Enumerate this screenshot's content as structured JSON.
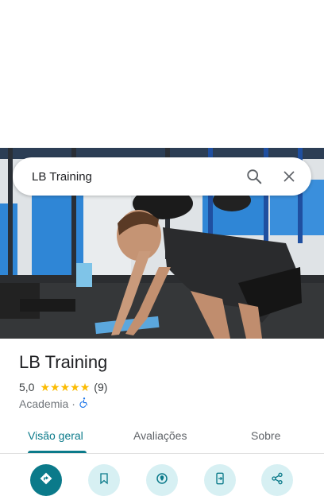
{
  "search": {
    "query": "LB Training",
    "search_icon": "search-icon",
    "close_icon": "close-icon"
  },
  "place": {
    "name": "LB Training",
    "rating": "5,0",
    "stars": 5,
    "review_count": "(9)",
    "category": "Academia",
    "separator": "·",
    "accessibility_icon": "wheelchair-icon"
  },
  "tabs": [
    {
      "label": "Visão geral",
      "active": true
    },
    {
      "label": "Avaliações",
      "active": false
    },
    {
      "label": "Sobre",
      "active": false
    }
  ],
  "actions": [
    {
      "icon": "directions-icon"
    },
    {
      "icon": "bookmark-icon"
    },
    {
      "icon": "nearby-icon"
    },
    {
      "icon": "send-to-phone-icon"
    },
    {
      "icon": "share-icon"
    }
  ],
  "colors": {
    "accent": "#0b7a8a",
    "star": "#fbbc04",
    "action_bg": "#d7f0f3"
  }
}
